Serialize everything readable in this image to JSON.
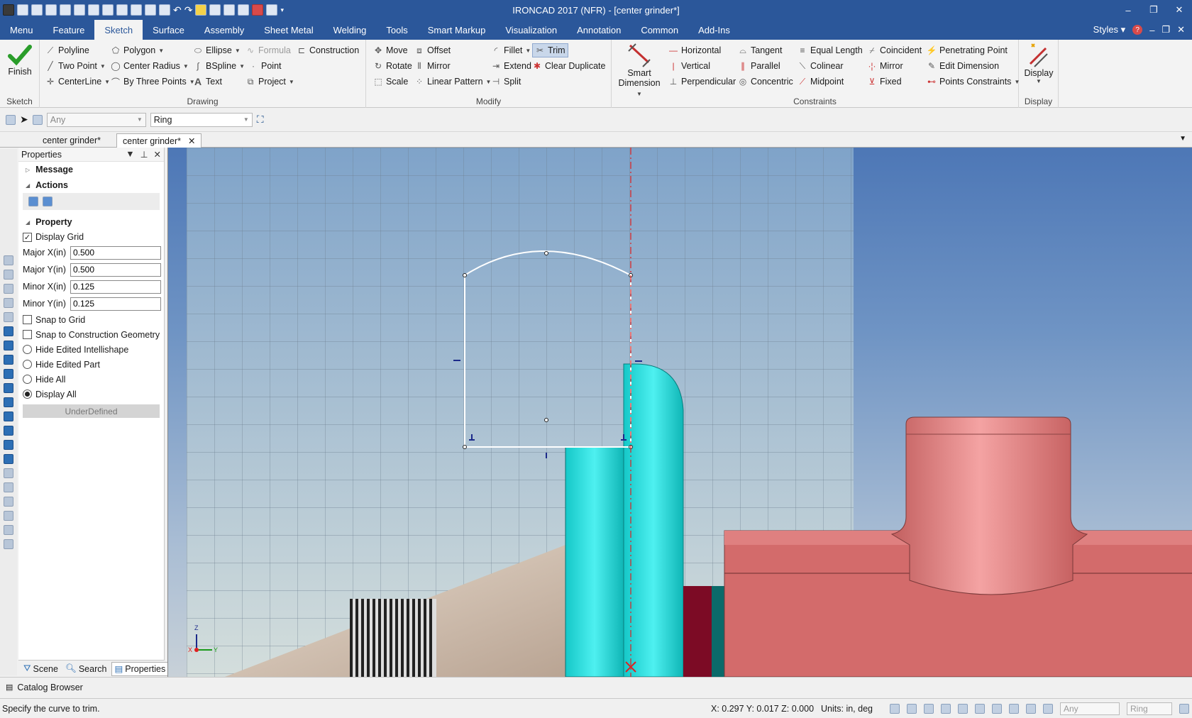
{
  "app": {
    "title": "IRONCAD 2017 (NFR) - [center grinder*]"
  },
  "window_controls": {
    "minimize": "–",
    "restore": "❐",
    "close": "✕"
  },
  "ribbon_tabs": [
    {
      "label": "Menu"
    },
    {
      "label": "Feature"
    },
    {
      "label": "Sketch"
    },
    {
      "label": "Surface"
    },
    {
      "label": "Assembly"
    },
    {
      "label": "Sheet Metal"
    },
    {
      "label": "Welding"
    },
    {
      "label": "Tools"
    },
    {
      "label": "Smart Markup"
    },
    {
      "label": "Visualization"
    },
    {
      "label": "Annotation"
    },
    {
      "label": "Common"
    },
    {
      "label": "Add-Ins"
    }
  ],
  "tab_right": {
    "styles": "Styles",
    "help": "?"
  },
  "ribbon": {
    "sketch_group": {
      "finish": "Finish",
      "label": "Sketch"
    },
    "drawing_group": {
      "label": "Drawing",
      "polyline": "Polyline",
      "polygon": "Polygon",
      "ellipse": "Ellipse",
      "formula": "Formula",
      "construction": "Construction",
      "two_point": "Two Point",
      "center_radius": "Center Radius",
      "bspline": "BSpline",
      "point": "Point",
      "centerline": "CenterLine",
      "by_three_points": "By Three Points",
      "text": "Text",
      "project": "Project"
    },
    "modify_group": {
      "label": "Modify",
      "move": "Move",
      "offset": "Offset",
      "fillet": "Fillet",
      "trim": "Trim",
      "rotate": "Rotate",
      "mirror": "Mirror",
      "extend": "Extend",
      "clear_duplicate": "Clear Duplicate",
      "scale": "Scale",
      "linear_pattern": "Linear Pattern",
      "split": "Split"
    },
    "constraints_group": {
      "label": "Constraints",
      "smart_dimension_1": "Smart",
      "smart_dimension_2": "Dimension",
      "horizontal": "Horizontal",
      "tangent": "Tangent",
      "equal_length": "Equal Length",
      "coincident": "Coincident",
      "penetrating_point": "Penetrating Point",
      "vertical": "Vertical",
      "parallel": "Parallel",
      "colinear": "Colinear",
      "mirror": "Mirror",
      "edit_dimension": "Edit Dimension",
      "perpendicular": "Perpendicular",
      "concentric": "Concentric",
      "midpoint": "Midpoint",
      "fixed": "Fixed",
      "points_constraints": "Points Constraints"
    },
    "display_group": {
      "display": "Display",
      "label": "Display"
    }
  },
  "selection_bar": {
    "filter": "Any",
    "mode": "Ring"
  },
  "doc_tabs": [
    {
      "label": "center grinder*"
    },
    {
      "label": "center grinder*"
    }
  ],
  "properties": {
    "title": "Properties",
    "message_section": "Message",
    "actions_section": "Actions",
    "property_section": "Property",
    "display_grid": "Display Grid",
    "fields": [
      {
        "label": "Major X(in)",
        "value": "0.500"
      },
      {
        "label": "Major Y(in)",
        "value": "0.500"
      },
      {
        "label": "Minor X(in)",
        "value": "0.125"
      },
      {
        "label": "Minor Y(in)",
        "value": "0.125"
      }
    ],
    "snap_to_grid": "Snap to Grid",
    "snap_to_construction": "Snap to Construction Geometry",
    "radios": [
      {
        "label": "Hide Edited Intellishape",
        "checked": false
      },
      {
        "label": "Hide Edited Part",
        "checked": false
      },
      {
        "label": "Hide All",
        "checked": false
      },
      {
        "label": "Display All",
        "checked": true
      }
    ],
    "underdefined": "UnderDefined",
    "bottom_tabs": {
      "scene": "Scene",
      "search": "Search",
      "properties": "Properties"
    }
  },
  "viewport": {
    "triad": {
      "z": "Z",
      "x": "X",
      "y": "Y"
    }
  },
  "catalog_browser": "Catalog Browser",
  "status": {
    "message": "Specify the curve to trim.",
    "coords": "X: 0.297 Y: 0.017 Z: 0.000",
    "units": "Units: in, deg",
    "filter": "Any",
    "mode": "Ring"
  }
}
